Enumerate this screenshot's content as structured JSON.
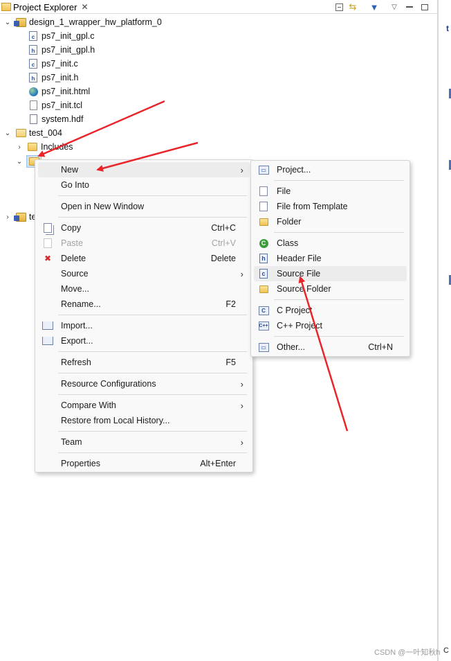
{
  "view": {
    "title": "Project Explorer",
    "close_glyph": "✕",
    "toolbar_icons": [
      "collapse-all-icon",
      "link-with-editor-icon",
      "filter-icon",
      "view-menu-icon",
      "minimize-icon",
      "maximize-icon"
    ]
  },
  "tree": {
    "platform_project": "design_1_wrapper_hw_platform_0",
    "platform_files": [
      "ps7_init_gpl.c",
      "ps7_init_gpl.h",
      "ps7_init.c",
      "ps7_init.h",
      "ps7_init.html",
      "ps7_init.tcl",
      "system.hdf"
    ],
    "app_project": "test_004",
    "includes": "Includes",
    "collapsed_project_prefix": "te"
  },
  "context_menu": {
    "items": [
      {
        "label": "New",
        "submenu": true
      },
      {
        "label": "Go Into"
      },
      {
        "label": "Open in New Window"
      },
      {
        "label": "Copy",
        "shortcut": "Ctrl+C"
      },
      {
        "label": "Paste",
        "shortcut": "Ctrl+V",
        "disabled": true
      },
      {
        "label": "Delete",
        "shortcut": "Delete"
      },
      {
        "label": "Source",
        "submenu": true
      },
      {
        "label": "Move..."
      },
      {
        "label": "Rename...",
        "shortcut": "F2"
      },
      {
        "label": "Import..."
      },
      {
        "label": "Export..."
      },
      {
        "label": "Refresh",
        "shortcut": "F5"
      },
      {
        "label": "Resource Configurations",
        "submenu": true
      },
      {
        "label": "Compare With",
        "submenu": true
      },
      {
        "label": "Restore from Local History..."
      },
      {
        "label": "Team",
        "submenu": true
      },
      {
        "label": "Properties",
        "shortcut": "Alt+Enter"
      }
    ]
  },
  "new_submenu": {
    "items": [
      {
        "label": "Project..."
      },
      {
        "label": "File"
      },
      {
        "label": "File from Template"
      },
      {
        "label": "Folder"
      },
      {
        "label": "Class"
      },
      {
        "label": "Header File"
      },
      {
        "label": "Source File"
      },
      {
        "label": "Source Folder"
      },
      {
        "label": "C Project"
      },
      {
        "label": "C++ Project"
      },
      {
        "label": "Other...",
        "shortcut": "Ctrl+N"
      }
    ]
  },
  "editor_edge": {
    "letter": "t",
    "tail": "C"
  },
  "watermark": "CSDN @一叶知秋h",
  "colors": {
    "annotation_arrow": "#e8262a",
    "highlight": "#ececec",
    "selection": "#cfe3f7"
  }
}
